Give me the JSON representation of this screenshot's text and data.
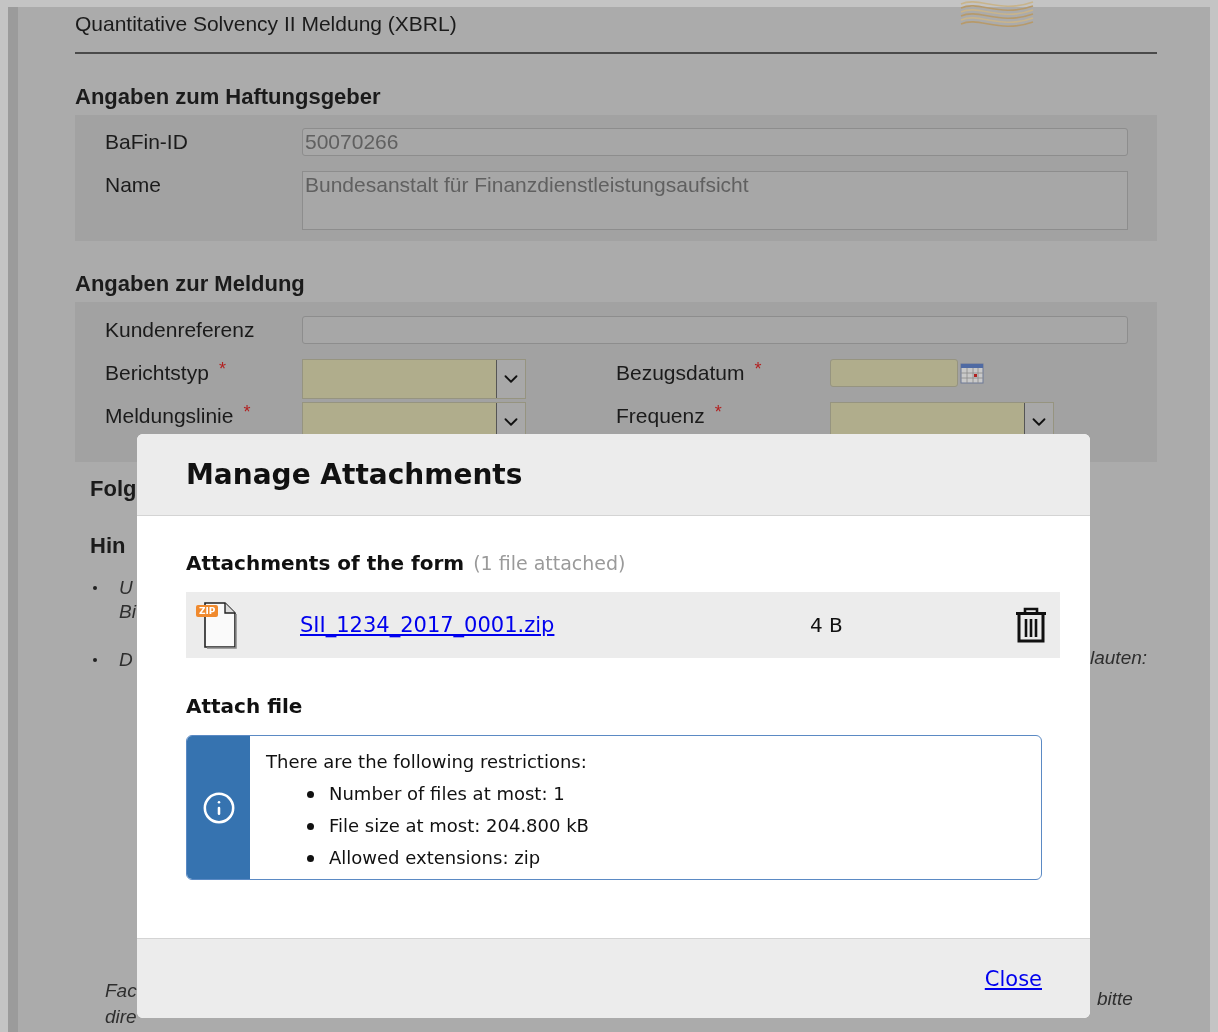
{
  "page": {
    "title": "Quantitative Solvency II Meldung (XBRL)"
  },
  "issuer": {
    "heading": "Angaben zum Haftungsgeber",
    "fields": [
      {
        "label": "BaFin-ID",
        "value": "50070266",
        "kind": "text"
      },
      {
        "label": "Name",
        "value": "Bundesanstalt für Finanzdienstleistungsaufsicht",
        "kind": "textarea"
      }
    ]
  },
  "report": {
    "heading": "Angaben zur Meldung",
    "reference": {
      "label": "Kundenreferenz"
    },
    "rows": [
      [
        {
          "label": "Berichtstyp",
          "marker": "*",
          "kind": "select"
        },
        {
          "label": "Bezugsdatum",
          "marker": "*",
          "kind": "date"
        }
      ],
      [
        {
          "label": "Meldungslinie",
          "marker": "*",
          "kind": "select"
        },
        {
          "label": "Frequenz",
          "marker": "*",
          "kind": "select"
        }
      ]
    ]
  },
  "background_fragments": {
    "left": [
      {
        "text": "Folg",
        "kind": "heading"
      },
      {
        "text": "Hin",
        "kind": "heading"
      },
      {
        "text": "U",
        "kind": "bullet"
      },
      {
        "text": "Bi",
        "kind": "continuation"
      },
      {
        "text": "D",
        "kind": "bullet"
      },
      {
        "text": "Fac",
        "kind": "note"
      },
      {
        "text": "dire",
        "kind": "note"
      }
    ],
    "right": [
      {
        "text": "lauten:",
        "kind": "line"
      },
      {
        "text": "bitte",
        "kind": "note"
      }
    ]
  },
  "dialog": {
    "title": "Manage Attachments",
    "attachments_heading": "Attachments of the form",
    "attachments_count": "(1 file attached)",
    "files": [
      {
        "name": "SII_1234_2017_0001.zip",
        "size": "4 B",
        "badge": "ZIP"
      }
    ],
    "attach_heading": "Attach file",
    "info": {
      "intro": "There are the following restrictions:",
      "items": [
        "Number of files at most: 1",
        "File size at most: 204.800 kB",
        "Allowed extensions: zip"
      ]
    },
    "close": "Close"
  }
}
